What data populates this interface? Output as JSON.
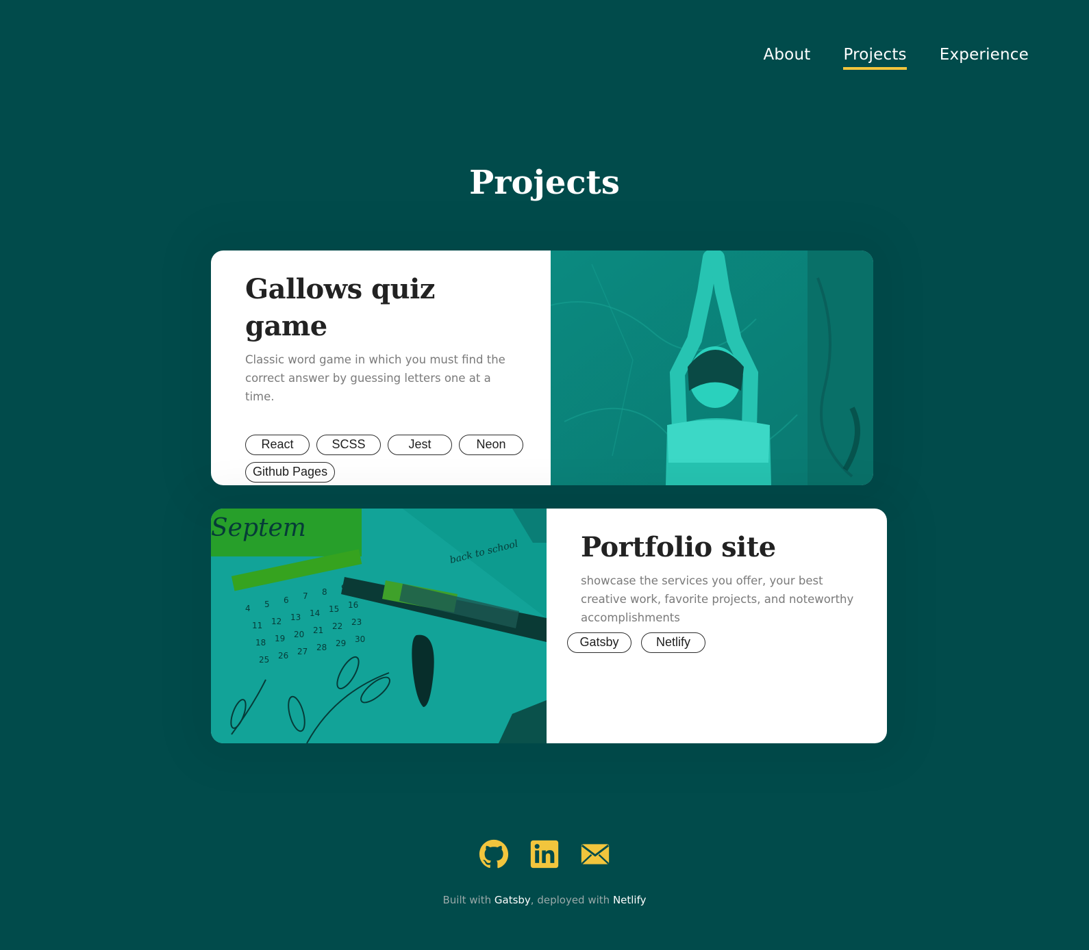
{
  "nav": {
    "items": [
      {
        "label": "About",
        "active": false
      },
      {
        "label": "Projects",
        "active": true
      },
      {
        "label": "Experience",
        "active": false
      }
    ]
  },
  "page": {
    "title": "Projects"
  },
  "projects": [
    {
      "title": "Gallows quiz game",
      "description": "Classic word game in which you must find the correct answer by guessing letters one at a time.",
      "tags": [
        "React",
        "SCSS",
        "Jest",
        "Neon",
        "Github Pages"
      ],
      "image": "woman-yoga-photo"
    },
    {
      "title": "Portfolio site",
      "description": "showcase the services you offer, your best creative work, favorite projects, and noteworthy accomplishments",
      "tags": [
        "Gatsby",
        "Netlify"
      ],
      "image": "calendar-notebook-photo"
    }
  ],
  "footer": {
    "icons": [
      "github-icon",
      "linkedin-icon",
      "mail-icon"
    ],
    "built_prefix": "Built with ",
    "built_tool": "Gatsby",
    "deployed_prefix": ", deployed with ",
    "deployed_tool": "Netlify"
  },
  "colors": {
    "background": "#014b4b",
    "accent": "#f2c53d",
    "card": "#ffffff",
    "image_tint": "#0f9d8e"
  }
}
